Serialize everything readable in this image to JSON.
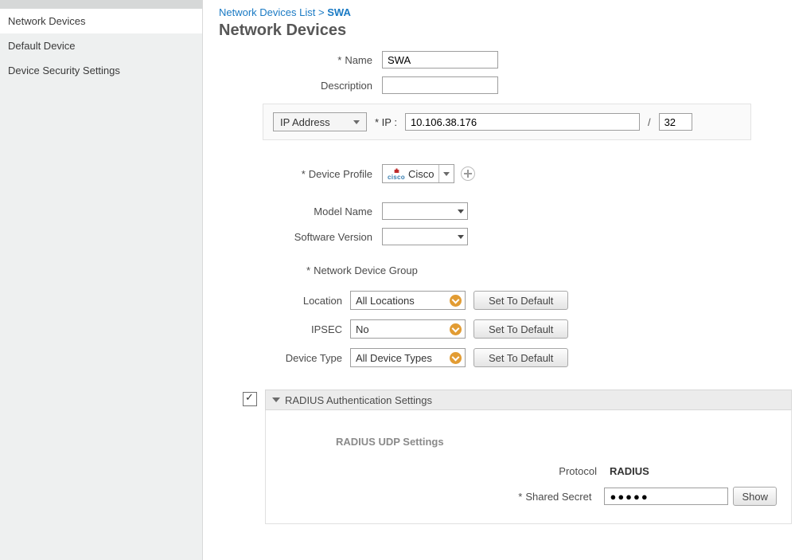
{
  "sidebar": {
    "items": [
      {
        "label": "Network Devices",
        "active": true
      },
      {
        "label": "Default Device",
        "active": false
      },
      {
        "label": "Device Security Settings",
        "active": false
      }
    ]
  },
  "breadcrumbs": {
    "parent": "Network Devices List",
    "sep": ">",
    "current": "SWA"
  },
  "page_title": "Network Devices",
  "form": {
    "name_label": "Name",
    "name_value": "SWA",
    "desc_label": "Description",
    "desc_value": ""
  },
  "ip": {
    "type_label": "IP Address",
    "ip_label": "* IP :",
    "ip_value": "10.106.38.176",
    "prefix_sep": "/",
    "prefix_value": "32"
  },
  "profile": {
    "label": "Device Profile",
    "value": "Cisco"
  },
  "model": {
    "label": "Model Name",
    "value": ""
  },
  "swver": {
    "label": "Software Version",
    "value": ""
  },
  "ndg": {
    "section_label": "Network Device Group",
    "rows": [
      {
        "label": "Location",
        "value": "All Locations",
        "btn": "Set To Default"
      },
      {
        "label": "IPSEC",
        "value": "No",
        "btn": "Set To Default"
      },
      {
        "label": "Device Type",
        "value": "All Device Types",
        "btn": "Set To Default"
      }
    ]
  },
  "radius": {
    "header": "RADIUS Authentication Settings",
    "subtitle": "RADIUS UDP Settings",
    "protocol_label": "Protocol",
    "protocol_value": "RADIUS",
    "secret_label": "Shared Secret",
    "secret_value": "●●●●●",
    "show_btn": "Show"
  }
}
